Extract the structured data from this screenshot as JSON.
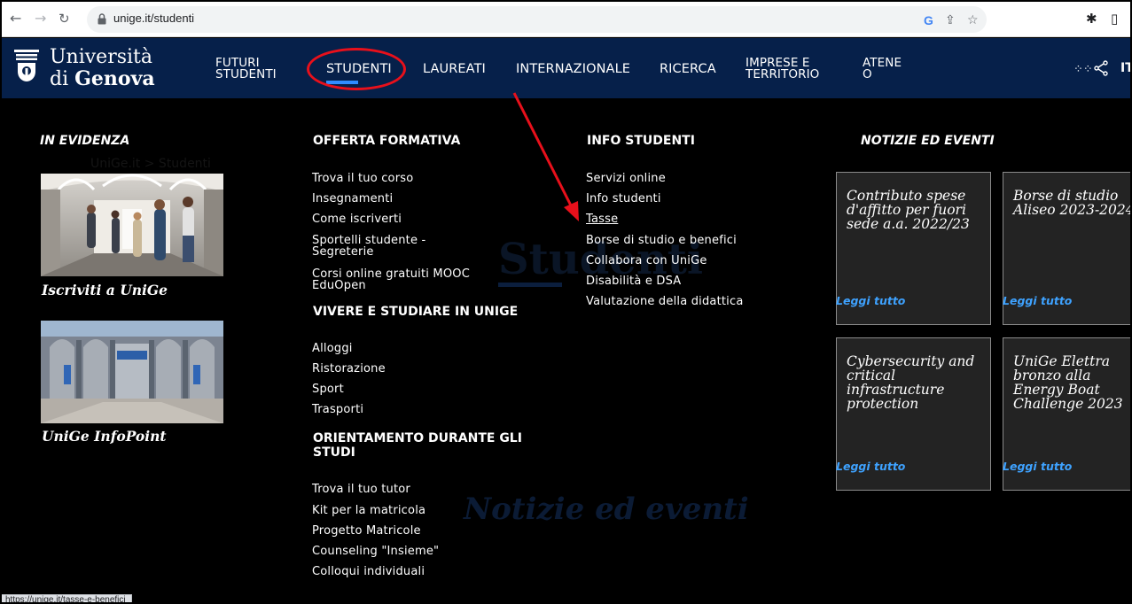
{
  "browser": {
    "url": "unige.it/studenti",
    "status_url": "https://unige.it/tasse-e-benefici"
  },
  "header": {
    "logo_line1": "Università",
    "logo_line2_prefix": "di",
    "logo_line2_bold": "Genova",
    "nav": [
      {
        "line1": "FUTURI",
        "line2": "STUDENTI"
      },
      {
        "line1": "STUDENTI",
        "line2": ""
      },
      {
        "line1": "LAUREATI",
        "line2": ""
      },
      {
        "line1": "INTERNAZIONALE",
        "line2": ""
      },
      {
        "line1": "RICERCA",
        "line2": ""
      },
      {
        "line1": "IMPRESE E",
        "line2": "TERRITORIO"
      },
      {
        "line1": "ATENE",
        "line2": "O"
      }
    ],
    "language": "IT"
  },
  "background": {
    "breadcrumb": "UniGe.it  >  Studenti",
    "page_title": "Studenti",
    "events_title": "Notizie ed eventi"
  },
  "menu": {
    "evidenza": {
      "heading": "IN EVIDENZA",
      "tiles": [
        {
          "caption": "Iscriviti a UniGe"
        },
        {
          "caption": "UniGe InfoPoint"
        }
      ]
    },
    "offerta": {
      "heading": "OFFERTA FORMATIVA",
      "links": [
        "Trova il tuo corso",
        "Insegnamenti",
        "Come iscriverti",
        "Sportelli studente -",
        "Segreterie",
        "Corsi online gratuiti MOOC",
        "EduOpen"
      ]
    },
    "vivere": {
      "heading": "VIVERE E STUDIARE IN UNIGE",
      "links": [
        "Alloggi",
        "Ristorazione",
        "Sport",
        "Trasporti"
      ]
    },
    "orientamento": {
      "heading_line1": "ORIENTAMENTO DURANTE GLI",
      "heading_line2": "STUDI",
      "links": [
        "Trova il tuo tutor",
        "Kit per la matricola",
        "Progetto Matricole",
        "Counseling \"Insieme\"",
        "Colloqui individuali"
      ]
    },
    "info": {
      "heading": "INFO STUDENTI",
      "links": [
        "Servizi online",
        "Info studenti",
        "Tasse",
        "Borse di studio e benefici",
        "Collabora con UniGe",
        "Disabilità e DSA",
        "Valutazione della didattica"
      ]
    },
    "news": {
      "heading": "NOTIZIE ED EVENTI",
      "read_more": "Leggi tutto",
      "cards": [
        {
          "title_lines": [
            "Contributo spese",
            "d'affitto per fuori",
            "sede a.a. 2022/23"
          ]
        },
        {
          "title_lines": [
            "Borse di studio",
            "Aliseo 2023-2024"
          ]
        },
        {
          "title_lines": [
            "Cybersecurity and",
            "critical",
            "infrastructure",
            "protection"
          ]
        },
        {
          "title_lines": [
            "UniGe Elettra",
            "bronzo alla",
            "Energy Boat",
            "Challenge 2023"
          ]
        }
      ]
    }
  },
  "colors": {
    "header_bg": "#06204a",
    "accent_blue": "#2f8cff",
    "link_more": "#3ea2ff",
    "annotation_red": "#e8101b"
  }
}
